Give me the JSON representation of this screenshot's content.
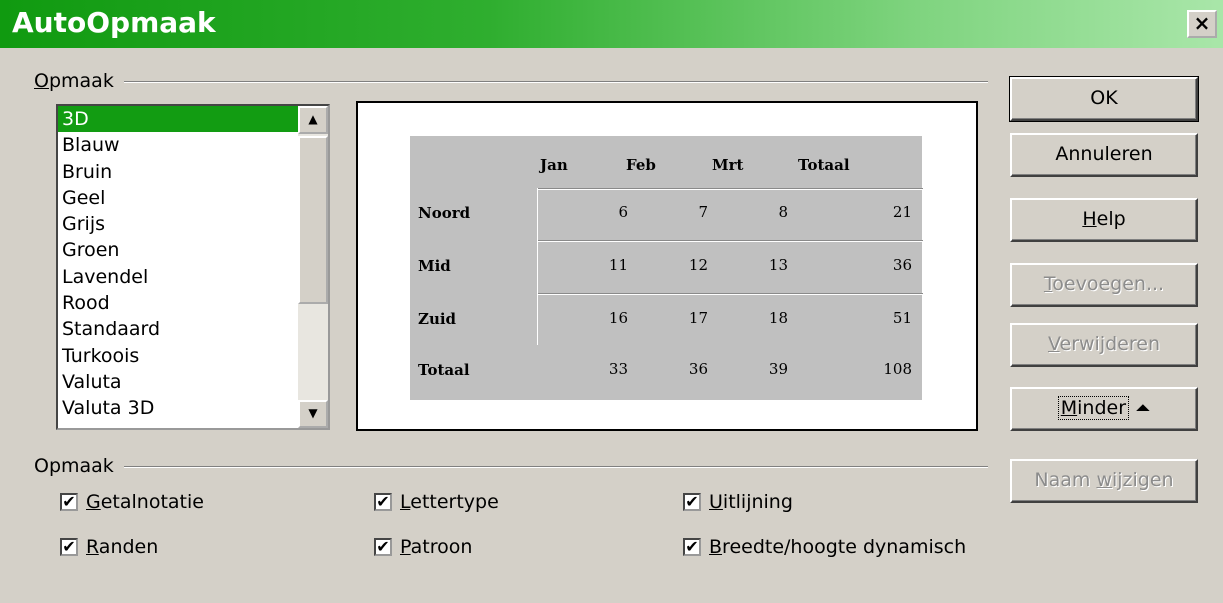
{
  "window": {
    "title": "AutoOpmaak",
    "close_label": "×"
  },
  "format_group": {
    "label_prefix": "",
    "label_underlined": "O",
    "label_rest": "pmaak"
  },
  "list": {
    "items": [
      "3D",
      "Blauw",
      "Bruin",
      "Geel",
      "Grijs",
      "Groen",
      "Lavendel",
      "Rood",
      "Standaard",
      "Turkoois",
      "Valuta",
      "Valuta 3D"
    ],
    "selected": "3D",
    "scroll_up": "▲",
    "scroll_down": "▼"
  },
  "preview": {
    "columns": [
      "Jan",
      "Feb",
      "Mrt",
      "Totaal"
    ],
    "rows": [
      {
        "label": "Noord",
        "values": [
          "6",
          "7",
          "8",
          "21"
        ]
      },
      {
        "label": "Mid",
        "values": [
          "11",
          "12",
          "13",
          "36"
        ]
      },
      {
        "label": "Zuid",
        "values": [
          "16",
          "17",
          "18",
          "51"
        ]
      },
      {
        "label": "Totaal",
        "values": [
          "33",
          "36",
          "39",
          "108"
        ]
      }
    ]
  },
  "buttons": {
    "ok": "OK",
    "cancel": "Annuleren",
    "help_u": "H",
    "help_rest": "elp",
    "add_u": "T",
    "add_rest": "oevoegen...",
    "delete_u": "V",
    "delete_rest": "erwijderen",
    "less_u": "M",
    "less_rest": "inder",
    "less_icon": "⏶",
    "rename_pre": "Naam ",
    "rename_u": "w",
    "rename_rest": "ijzigen"
  },
  "options_group": {
    "label": "Opmaak"
  },
  "options": {
    "number_format": {
      "u": "G",
      "rest": "etalnotatie",
      "checked": "✔"
    },
    "font": {
      "u": "L",
      "rest": "ettertype",
      "checked": "✔"
    },
    "alignment": {
      "u": "U",
      "rest": "itlijning",
      "checked": "✔"
    },
    "borders": {
      "u": "R",
      "rest": "anden",
      "checked": "✔"
    },
    "pattern": {
      "u": "P",
      "rest": "atroon",
      "checked": "✔"
    },
    "autofit": {
      "u": "B",
      "rest": "reedte/hoogte dynamisch",
      "checked": "✔"
    }
  },
  "colors": {
    "titlebar": "#109a10",
    "selection": "#129c12",
    "preview_table": "#c0c0c0"
  }
}
